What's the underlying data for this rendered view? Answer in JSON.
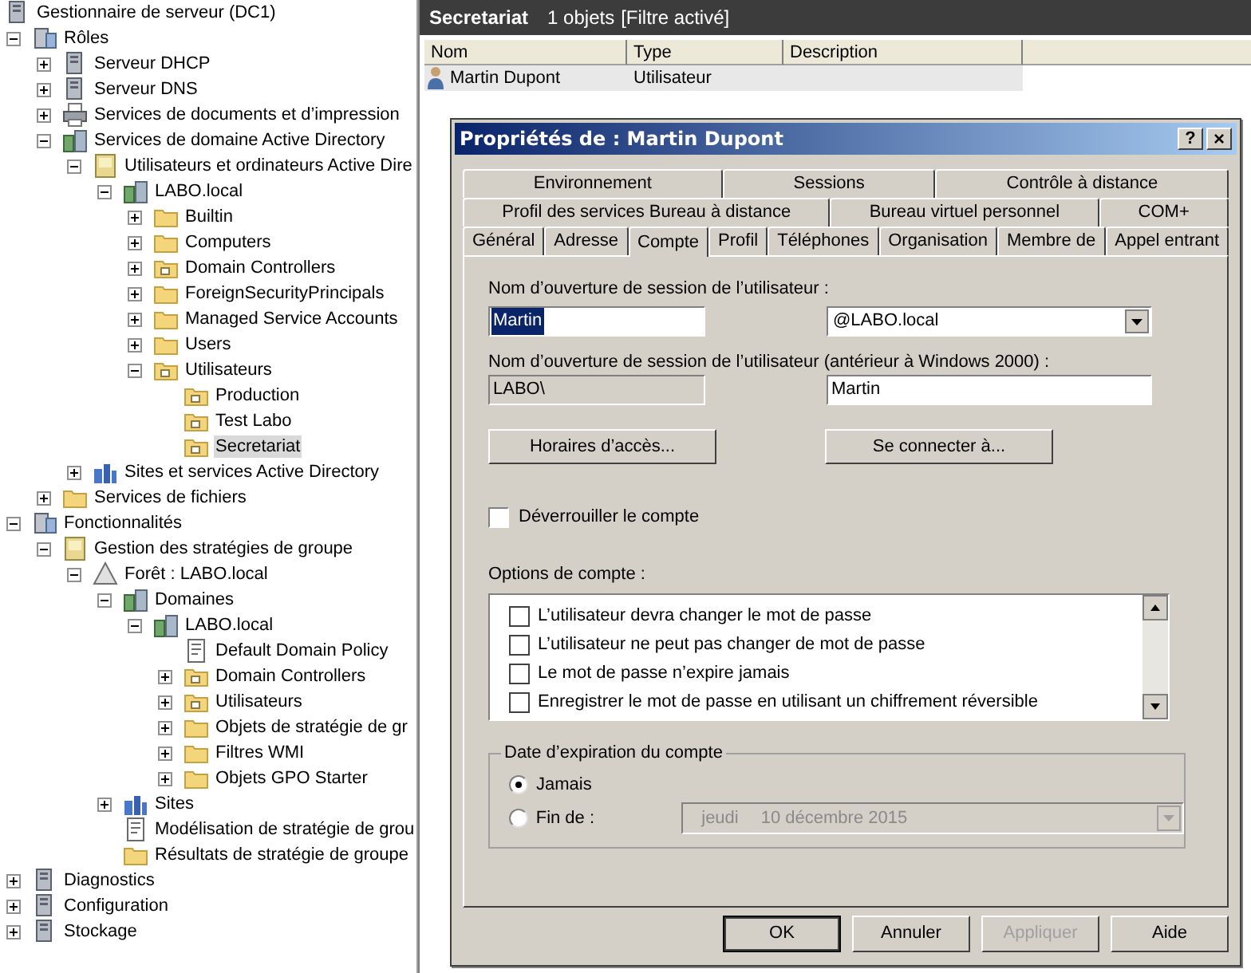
{
  "tree": {
    "label": "Gestionnaire de serveur (DC1)",
    "kind": "server",
    "selected": false,
    "children": [
      {
        "label": "Rôles",
        "kind": "roles",
        "expanded": true,
        "selected": false,
        "children": [
          {
            "label": "Serveur DHCP",
            "kind": "server",
            "expanded": false,
            "selected": false
          },
          {
            "label": "Serveur DNS",
            "kind": "server",
            "expanded": false,
            "selected": false
          },
          {
            "label": "Services de documents et d’impression",
            "kind": "printer",
            "expanded": false,
            "selected": false
          },
          {
            "label": "Services de domaine Active Directory",
            "kind": "domain",
            "expanded": true,
            "selected": false,
            "children": [
              {
                "label": "Utilisateurs et ordinateurs Active Dire",
                "kind": "console",
                "expanded": true,
                "selected": false,
                "children": [
                  {
                    "label": "LABO.local",
                    "kind": "domain",
                    "expanded": true,
                    "selected": false,
                    "children": [
                      {
                        "label": "Builtin",
                        "kind": "folder",
                        "expanded": false,
                        "selected": false
                      },
                      {
                        "label": "Computers",
                        "kind": "folder",
                        "expanded": false,
                        "selected": false
                      },
                      {
                        "label": "Domain Controllers",
                        "kind": "ou",
                        "expanded": false,
                        "selected": false
                      },
                      {
                        "label": "ForeignSecurityPrincipals",
                        "kind": "folder",
                        "expanded": false,
                        "selected": false
                      },
                      {
                        "label": "Managed Service Accounts",
                        "kind": "folder",
                        "expanded": false,
                        "selected": false
                      },
                      {
                        "label": "Users",
                        "kind": "folder",
                        "expanded": false,
                        "selected": false
                      },
                      {
                        "label": "Utilisateurs",
                        "kind": "ou",
                        "expanded": true,
                        "selected": false,
                        "children": [
                          {
                            "label": "Production",
                            "kind": "ou",
                            "selected": false
                          },
                          {
                            "label": "Test Labo",
                            "kind": "ou",
                            "selected": false
                          },
                          {
                            "label": "Secretariat",
                            "kind": "ou",
                            "selected": true
                          }
                        ]
                      }
                    ]
                  }
                ]
              },
              {
                "label": "Sites et services Active Directory",
                "kind": "sites",
                "expanded": false,
                "selected": false
              }
            ]
          },
          {
            "label": "Services de fichiers",
            "kind": "folder",
            "expanded": false,
            "selected": false
          }
        ]
      },
      {
        "label": "Fonctionnalités",
        "kind": "roles",
        "expanded": true,
        "selected": false,
        "children": [
          {
            "label": "Gestion des stratégies de groupe",
            "kind": "console",
            "expanded": true,
            "selected": false,
            "children": [
              {
                "label": "Forêt : LABO.local",
                "kind": "forest",
                "expanded": true,
                "selected": false,
                "children": [
                  {
                    "label": "Domaines",
                    "kind": "domain",
                    "expanded": true,
                    "selected": false,
                    "children": [
                      {
                        "label": "LABO.local",
                        "kind": "domain",
                        "expanded": true,
                        "selected": false,
                        "children": [
                          {
                            "label": "Default Domain Policy",
                            "kind": "policy",
                            "selected": false
                          },
                          {
                            "label": "Domain Controllers",
                            "kind": "ou",
                            "expanded": false,
                            "selected": false
                          },
                          {
                            "label": "Utilisateurs",
                            "kind": "ou",
                            "expanded": false,
                            "selected": false
                          },
                          {
                            "label": "Objets de stratégie de gr",
                            "kind": "folder",
                            "expanded": false,
                            "selected": false
                          },
                          {
                            "label": "Filtres WMI",
                            "kind": "folder",
                            "expanded": false,
                            "selected": false
                          },
                          {
                            "label": "Objets GPO Starter",
                            "kind": "folder",
                            "expanded": false,
                            "selected": false
                          }
                        ]
                      }
                    ]
                  },
                  {
                    "label": "Sites",
                    "kind": "sites",
                    "expanded": false,
                    "selected": false
                  },
                  {
                    "label": "Modélisation de stratégie de grou",
                    "kind": "policy",
                    "selected": false
                  },
                  {
                    "label": "Résultats de stratégie de groupe",
                    "kind": "folder",
                    "selected": false
                  }
                ]
              }
            ]
          }
        ]
      },
      {
        "label": "Diagnostics",
        "kind": "server",
        "expanded": false,
        "selected": false
      },
      {
        "label": "Configuration",
        "kind": "server",
        "expanded": false,
        "selected": false
      },
      {
        "label": "Stockage",
        "kind": "server",
        "expanded": false,
        "selected": false
      }
    ]
  },
  "header": {
    "title": "Secretariat",
    "count": "1 objets",
    "filter": "[Filtre activé]"
  },
  "list": {
    "columns": [
      "Nom",
      "Type",
      "Description"
    ],
    "rows": [
      {
        "name": "Martin Dupont",
        "type": "Utilisateur",
        "selected": true
      }
    ]
  },
  "dialog": {
    "title": "Propriétés de : Martin Dupont",
    "help_button": "?",
    "close_button": "×",
    "tab_rows": [
      [
        {
          "label": "Environnement",
          "selected": false
        },
        {
          "label": "Sessions",
          "selected": false
        },
        {
          "label": "Contrôle à distance",
          "selected": false
        }
      ],
      [
        {
          "label": "Profil des services Bureau à distance",
          "selected": false
        },
        {
          "label": "Bureau virtuel personnel",
          "selected": false
        },
        {
          "label": "COM+",
          "selected": false
        }
      ],
      [
        {
          "label": "Général",
          "selected": false
        },
        {
          "label": "Adresse",
          "selected": false
        },
        {
          "label": "Compte",
          "selected": true
        },
        {
          "label": "Profil",
          "selected": false
        },
        {
          "label": "Téléphones",
          "selected": false
        },
        {
          "label": "Organisation",
          "selected": false
        },
        {
          "label": "Membre de",
          "selected": false
        },
        {
          "label": "Appel entrant",
          "selected": false
        }
      ]
    ],
    "logon_label": "Nom d’ouverture de session de l’utilisateur :",
    "logon_name": {
      "value": "Martin",
      "text_selected": true
    },
    "logon_domain": "@LABO.local",
    "legacy_label": "Nom d’ouverture de session de l’utilisateur (antérieur à Windows 2000) :",
    "legacy_domain": {
      "value": "LABO\\",
      "disabled": true
    },
    "legacy_name": {
      "value": "Martin",
      "disabled": false
    },
    "hours_button": "Horaires d’accès...",
    "logon_to_button": "Se connecter à...",
    "unlock": {
      "label": "Déverrouiller le compte",
      "checked": false
    },
    "options_label": "Options de compte :",
    "options": [
      {
        "label": "L’utilisateur devra changer le mot de passe",
        "checked": false
      },
      {
        "label": "L’utilisateur ne peut pas changer de mot de passe",
        "checked": false
      },
      {
        "label": "Le mot de passe n’expire jamais",
        "checked": false
      },
      {
        "label": "Enregistrer le mot de passe en utilisant un chiffrement réversible",
        "checked": false
      }
    ],
    "expiry": {
      "title": "Date d’expiration du compte",
      "choices": [
        {
          "label": "Jamais",
          "selected": true
        },
        {
          "label": "Fin de :",
          "selected": false
        }
      ],
      "date": {
        "day": "jeudi",
        "date": "10 décembre 2015",
        "disabled": true
      }
    },
    "buttons": [
      {
        "label": "OK",
        "default": true,
        "disabled": false
      },
      {
        "label": "Annuler",
        "default": false,
        "disabled": false
      },
      {
        "label": "Appliquer",
        "default": false,
        "disabled": true
      },
      {
        "label": "Aide",
        "default": false,
        "disabled": false
      }
    ]
  }
}
